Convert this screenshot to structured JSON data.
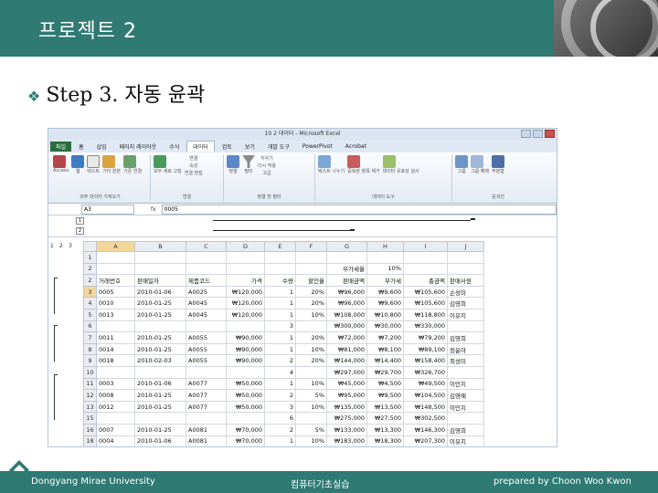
{
  "slide": {
    "title": "프로젝트 2",
    "subtitle": "Step 3. 자동 윤곽",
    "footer_left": "Dongyang Mirae University",
    "footer_center": "컴퓨터기초실습",
    "footer_right": "prepared by Choon Woo Kwon",
    "accent_color": "#2f7a72"
  },
  "excel": {
    "window_title": "10 2 데이터 - Microsoft Excel",
    "tabs": [
      "파일",
      "홈",
      "삽입",
      "페이지 레이아웃",
      "수식",
      "데이터",
      "검토",
      "보기",
      "개발 도구",
      "PowerPivot",
      "Acrobat"
    ],
    "active_tab": "데이터",
    "ribbon_groups": [
      {
        "label": "외부 데이터 가져오기",
        "items": [
          "Access",
          "웹",
          "텍스트",
          "기타 원본",
          "기존 연결"
        ]
      },
      {
        "label": "연결",
        "items": [
          "모두 새로 고침",
          "연결",
          "속성",
          "연결 편집"
        ]
      },
      {
        "label": "정렬 및 필터",
        "items": [
          "정렬",
          "필터",
          "지우기",
          "다시 적용",
          "고급"
        ]
      },
      {
        "label": "데이터 도구",
        "items": [
          "텍스트 나누기",
          "중복된 항목 제거",
          "데이터 유효성 검사",
          "통합",
          "가상 분석"
        ]
      },
      {
        "label": "윤곽선",
        "items": [
          "그룹",
          "그룹 해제",
          "부분합"
        ]
      }
    ],
    "name_box": "A3",
    "fx_label": "fx",
    "formula_value": "0005",
    "outline_levels": [
      "1",
      "2",
      "3"
    ],
    "row_outline_levels": [
      "1",
      "2",
      "3"
    ],
    "columns": [
      "A",
      "B",
      "C",
      "D",
      "E",
      "F",
      "G",
      "H",
      "I",
      "J"
    ],
    "rows": [
      {
        "num": "1",
        "cells": [
          "",
          "",
          "",
          "",
          "",
          "",
          "",
          "",
          "",
          ""
        ]
      },
      {
        "num": "2",
        "cells": [
          "",
          "",
          "",
          "",
          "",
          "",
          "부가세율",
          "10%",
          "",
          ""
        ]
      },
      {
        "num": "2",
        "cells": [
          "거래번호",
          "판매일자",
          "제품코드",
          "가격",
          "수량",
          "할인율",
          "판매금액",
          "부가세",
          "총금액",
          "판매사원"
        ]
      },
      {
        "num": "3",
        "cells": [
          "0005",
          "2010-01-06",
          "A0025",
          "₩120,000",
          "1",
          "20%",
          "₩96,000",
          "₩9,600",
          "₩105,600",
          "손성미"
        ]
      },
      {
        "num": "4",
        "cells": [
          "0010",
          "2010-01-25",
          "A0045",
          "₩120,000",
          "1",
          "20%",
          "₩96,000",
          "₩9,600",
          "₩105,600",
          "김영희"
        ]
      },
      {
        "num": "5",
        "cells": [
          "0013",
          "2010-01-25",
          "A0045",
          "₩120,000",
          "1",
          "10%",
          "₩108,000",
          "₩10,800",
          "₩118,800",
          "이유지"
        ]
      },
      {
        "num": "6",
        "cells": [
          "",
          "",
          "",
          "",
          "3",
          "",
          "₩300,000",
          "₩30,000",
          "₩330,000",
          ""
        ]
      },
      {
        "num": "7",
        "cells": [
          "0011",
          "2010-01-25",
          "A0055",
          "₩90,000",
          "1",
          "20%",
          "₩72,000",
          "₩7,200",
          "₩79,200",
          "김영희"
        ]
      },
      {
        "num": "8",
        "cells": [
          "0014",
          "2010-01-25",
          "A0055",
          "₩90,000",
          "1",
          "10%",
          "₩81,000",
          "₩8,100",
          "₩89,100",
          "정윤아"
        ]
      },
      {
        "num": "9",
        "cells": [
          "0018",
          "2010-02-03",
          "A0055",
          "₩90,000",
          "2",
          "20%",
          "₩144,000",
          "₩14,400",
          "₩158,400",
          "최성미"
        ]
      },
      {
        "num": "10",
        "cells": [
          "",
          "",
          "",
          "",
          "4",
          "",
          "₩297,000",
          "₩29,700",
          "₩326,700",
          ""
        ]
      },
      {
        "num": "11",
        "cells": [
          "0003",
          "2010-01-06",
          "A0077",
          "₩50,000",
          "1",
          "10%",
          "₩45,000",
          "₩4,500",
          "₩49,500",
          "이민지"
        ]
      },
      {
        "num": "12",
        "cells": [
          "0008",
          "2010-01-25",
          "A0077",
          "₩50,000",
          "2",
          "5%",
          "₩95,000",
          "₩9,500",
          "₩104,500",
          "김영애"
        ]
      },
      {
        "num": "13",
        "cells": [
          "0012",
          "2010-01-25",
          "A0077",
          "₩50,000",
          "3",
          "10%",
          "₩135,000",
          "₩13,500",
          "₩148,500",
          "이민지"
        ]
      },
      {
        "num": "15",
        "cells": [
          "",
          "",
          "",
          "",
          "6",
          "",
          "₩275,000",
          "₩27,500",
          "₩302,500",
          ""
        ]
      },
      {
        "num": "16",
        "cells": [
          "0007",
          "2010-01-25",
          "A0081",
          "₩70,000",
          "2",
          "5%",
          "₩133,000",
          "₩13,300",
          "₩146,300",
          "김영희"
        ]
      },
      {
        "num": "18",
        "cells": [
          "0004",
          "2010-01-06",
          "A0081",
          "₩70,000",
          "1",
          "10%",
          "₩183,000",
          "₩18,300",
          "₩207,300",
          "이유지"
        ]
      }
    ]
  }
}
